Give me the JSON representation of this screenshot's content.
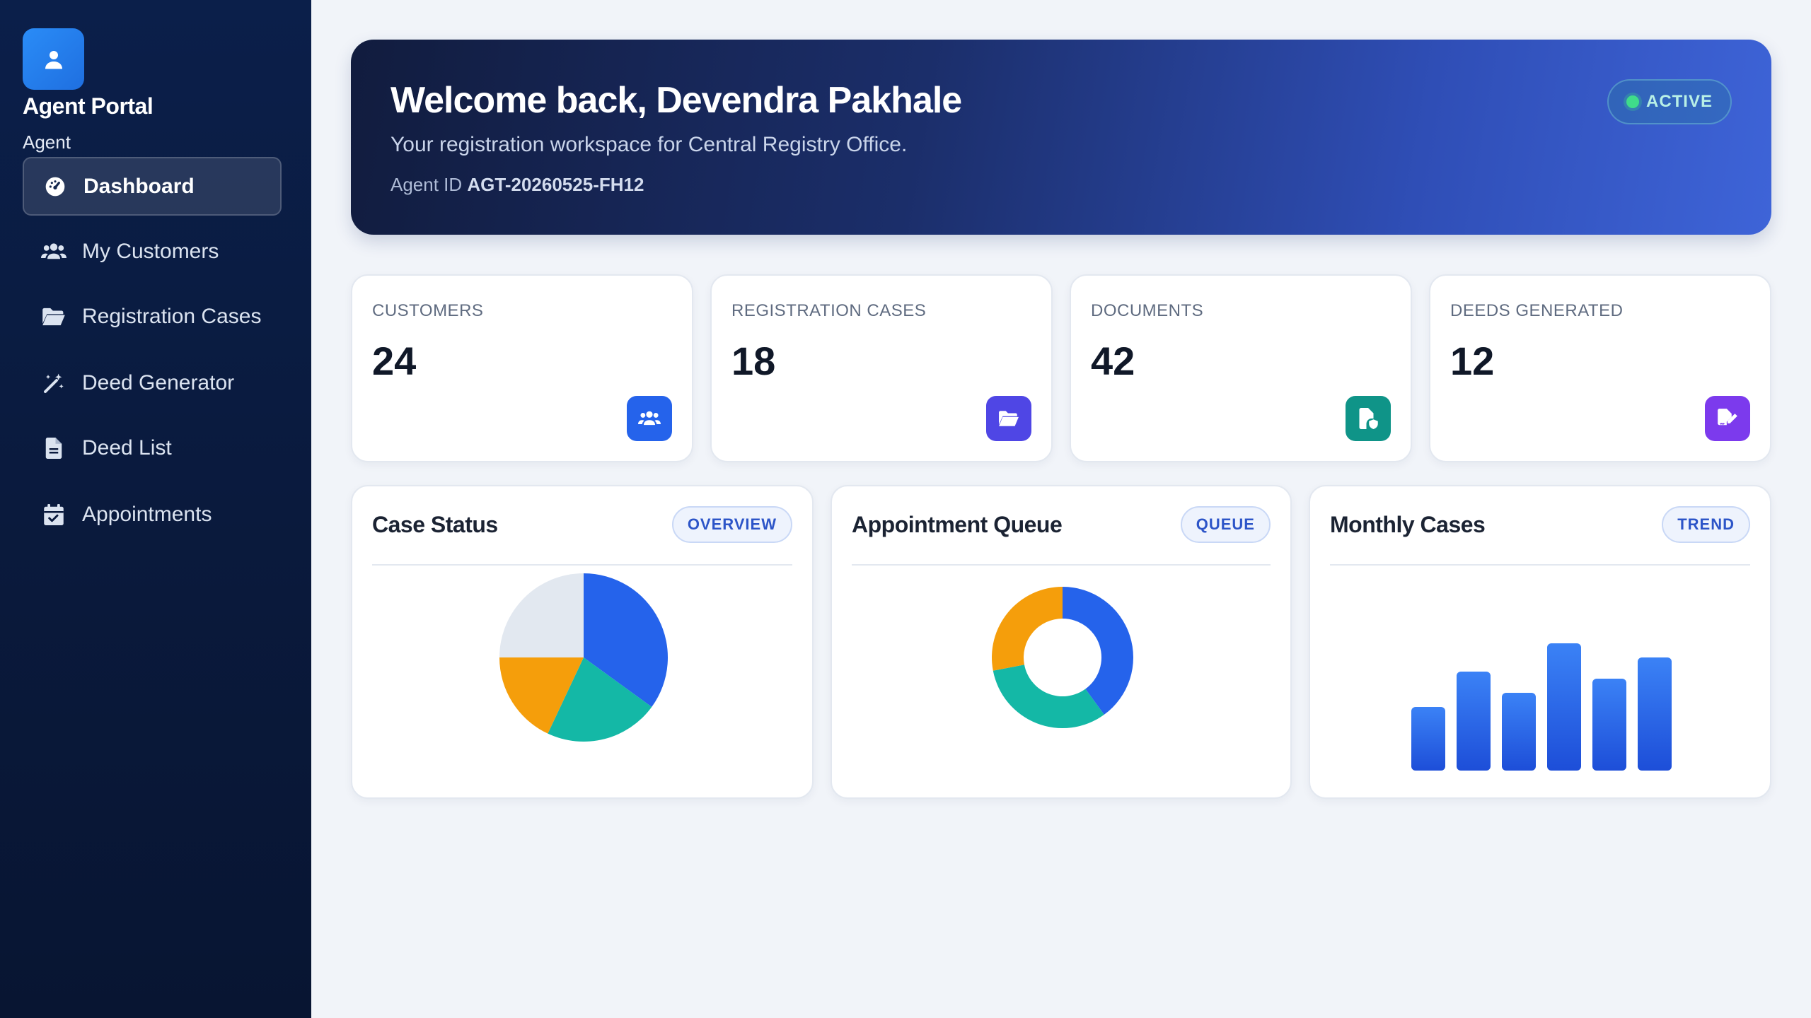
{
  "sidebar": {
    "brand": "Agent Portal",
    "role": "Agent",
    "items": [
      {
        "label": "Dashboard",
        "icon": "dashboard-gauge-icon",
        "active": true
      },
      {
        "label": "My Customers",
        "icon": "users-icon"
      },
      {
        "label": "Registration Cases",
        "icon": "folder-open-icon"
      },
      {
        "label": "Deed Generator",
        "icon": "magic-wand-icon"
      },
      {
        "label": "Deed List",
        "icon": "file-icon"
      },
      {
        "label": "Appointments",
        "icon": "calendar-check-icon"
      }
    ]
  },
  "hero": {
    "title": "Welcome back, Devendra Pakhale",
    "subtitle": "Your registration workspace for Central Registry Office.",
    "agent_id_label": "Agent ID",
    "agent_id": "AGT-20260525-FH12",
    "status": "ACTIVE"
  },
  "stats": [
    {
      "label": "CUSTOMERS",
      "value": "24",
      "icon": "users-icon",
      "color": "#2563eb"
    },
    {
      "label": "REGISTRATION CASES",
      "value": "18",
      "icon": "folder-open-icon",
      "color": "#4f46e5"
    },
    {
      "label": "DOCUMENTS",
      "value": "42",
      "icon": "file-shield-icon",
      "color": "#0f9488"
    },
    {
      "label": "DEEDS GENERATED",
      "value": "12",
      "icon": "file-signature-icon",
      "color": "#7c3aed"
    }
  ],
  "cards": [
    {
      "title": "Case Status",
      "badge": "OVERVIEW"
    },
    {
      "title": "Appointment Queue",
      "badge": "QUEUE"
    },
    {
      "title": "Monthly Cases",
      "badge": "TREND"
    }
  ],
  "chart_data": [
    {
      "type": "pie",
      "values": [
        35,
        22,
        18,
        25
      ],
      "colors": [
        "#2563eb",
        "#14b8a6",
        "#f59e0b",
        "#e2e8f0"
      ]
    },
    {
      "type": "pie",
      "donut": true,
      "values": [
        40,
        32,
        28
      ],
      "colors": [
        "#2563eb",
        "#14b8a6",
        "#f59e0b"
      ]
    },
    {
      "type": "bar",
      "values": [
        9,
        14,
        11,
        18,
        13,
        16
      ],
      "ylim": [
        0,
        18
      ],
      "colors": [
        "#3b82f6",
        "#1d4ed8"
      ]
    }
  ]
}
